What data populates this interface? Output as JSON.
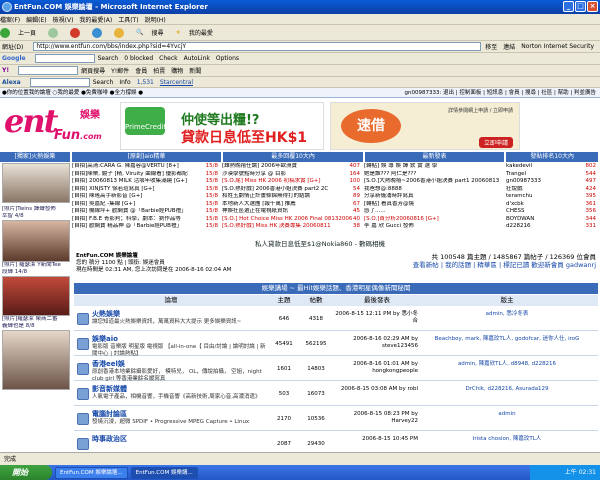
{
  "window": {
    "title": "EntFun.COM 娛樂論壇 - Microsoft Internet Explorer",
    "menu": [
      "檔案(F)",
      "編輯(E)",
      "檢視(V)",
      "我的最愛(A)",
      "工具(T)",
      "說明(H)"
    ]
  },
  "toolbar": {
    "back": "上一頁",
    "search": "搜尋",
    "favorites": "我的最愛",
    "address": "http://www.entfun.com/bbs/index.php?sid=4YvcjY",
    "go": "移至",
    "links": "連結",
    "norton": "Norton Internet Security"
  },
  "google_bar": {
    "search": "Search",
    "blocked": "0 blocked",
    "check": "Check",
    "autolink": "AutoLink",
    "options": "Options"
  },
  "yahoo_bar": [
    "網頁搜尋",
    "Y!郵件",
    "會員",
    "拍賣",
    "購物",
    "新聞",
    "新聞"
  ],
  "alexa_bar": {
    "label": "Alexa",
    "search": "Search",
    "info": "Info",
    "rank": "1,531",
    "site": "Starcentral"
  },
  "page": {
    "toplinks_left": "●你的位置我的論壇 ○我的最愛 ●免費咖啡 ●全力撐娛 ●",
    "toplinks_right": "gn00987333: 退出 | 控制面板 | 短訊息 | 會員 | 搜尋 | 社區 | 幫助 | 判並廣告",
    "logo": {
      "ent": "ent",
      "fun": "Fun",
      "com": ".com",
      "cn": "娛樂"
    },
    "ad1": {
      "brand": "PrimeCredit",
      "line1": "仲使等出糧!?",
      "line2": "貸款日息低至HK$1"
    },
    "ad2": {
      "mascot": "速借",
      "text": "詳情參閱網上申請 / 立即申請",
      "btn": "立即申請"
    },
    "colheads": [
      "[獨家]火熱娛樂",
      "[原創]aio精華",
      "最多回覆10大內",
      "最新發表",
      "發貼排名10大內"
    ],
    "col1": [
      "[照片]Twins 譯聲發佈",
      "萃智 4/8",
      "[照片] 羅瑟潔 Y新聞Tee",
      "段輝 14/8",
      "[照片]羅瑟潔 榮商二番",
      "義輝也是 8/8"
    ],
    "col2": [
      {
        "t": "[自拍]高清:CARA G. 陳嘉容@VERTU [8+]",
        "n": "15/8"
      },
      {
        "t": "[自拍]陳樂, 鏡子 [精, Viruity 曲線看] 優影都配",
        "n": "15/8"
      },
      {
        "t": "[自拍] 20060813 MILK 活壞年收集滿繞 [G+]",
        "n": "15/8"
      },
      {
        "t": "[自拍] XINJSTY 徐若瑄寫真 [G+]",
        "n": "15/8"
      },
      {
        "t": "[自拍] 陳瑤高手新影音 [G+]",
        "n": "15/8"
      },
      {
        "t": "[自拍] 吳嘉紀 -集線 [G+]",
        "n": "15/8"
      },
      {
        "t": "[自拍] 機線坪+ 歡網寶 @「Barbie經PUB禮」",
        "n": "15/8"
      },
      {
        "t": "[自拍] F.B.E 青影判；科學，劇本：劉作品等",
        "n": "15/8"
      },
      {
        "t": "[自拍] 歡網寶 精品神 @「Barbie經PUB禮」",
        "n": "15/8"
      }
    ],
    "col3": [
      {
        "t": "[難熱晚禧仕論] 2006年歐洲寶",
        "n": "407"
      },
      {
        "t": "沙漠學號點時分享 @ 目影",
        "n": "164"
      },
      {
        "t": "[S.O.尾] Miss HK 2006 初稿求實 [G+]",
        "n": "100"
      },
      {
        "t": "[S.O.熱好戲] 2006香港小姐決賽 part2 2C",
        "n": "54"
      },
      {
        "t": "和姓玉劇情正計畫條錦無得打的結論",
        "n": "89"
      },
      {
        "t": "本地新人大選團 [報千萬] 推薦",
        "n": "67"
      },
      {
        "t": "神娛社區選正在電視紙資訊",
        "n": "45"
      },
      {
        "t": "[S.O.] Hot Choice Miss HK 2006 Final 08132006",
        "n": "40"
      },
      {
        "t": "[S.O.熱好戲] Miss HK 決賽專集 20060811",
        "n": "38"
      }
    ],
    "col4": [
      {
        "t": "[轉貼] 娛 導 娛 譯",
        "n": "欽 實 選 學"
      },
      {
        "t": "她是誰??? 阿仁是???",
        "n": ""
      },
      {
        "t": "[S.O.]大熱晚禧~2006香港小姐決賽 part1 20060813",
        "n": ""
      },
      {
        "t": "我爸想@:8888",
        "n": ""
      },
      {
        "t": "分享新儀涌時評寫真",
        "n": ""
      },
      {
        "t": "[轉貼] 看真香芳@燒",
        "n": ""
      },
      {
        "t": "感了......",
        "n": ""
      },
      {
        "t": "[S.O.]首分析20060816 [G+]",
        "n": ""
      },
      {
        "t": "李 嘉 欣 Gucci 發佈",
        "n": ""
      }
    ],
    "col5": [
      {
        "t": "kakedevil",
        "n": "802"
      },
      {
        "t": "Trangel",
        "n": "544"
      },
      {
        "t": "gn00987333",
        "n": "497"
      },
      {
        "t": "狂說戲",
        "n": "424"
      },
      {
        "t": "teramchu",
        "n": "395"
      },
      {
        "t": "d'xcbk",
        "n": "361"
      },
      {
        "t": "CHESS",
        "n": "356"
      },
      {
        "t": "BOYDWAN",
        "n": "344"
      },
      {
        "t": "d228216",
        "n": "331"
      },
      {
        "t": "sharonhe",
        "n": "330"
      }
    ],
    "promo": "私人貸款日息低至$1@Nokia860 - 數碼相機",
    "userinfo": [
      "EntFun.COM 娛樂論壇",
      "您的 積分 1100 點 | 頭銜: 娛迷會員",
      "現在時間是 02:31 AM, 您上次訪問是在 2006-8-16 02:04 AM"
    ],
    "stats": {
      "line1": "共 100548 篇主題 / 1485867 篇帖子 / 126369 位會員",
      "line2": "查看新帖 | 我的話題 | 精華區 | 標記已讀 歡迎新會員 gadwanrj"
    },
    "forum_head": "娛樂講場 ~ 最Hit娛樂話題、香港明星偶像新聞秘聞",
    "forum_cols": [
      "論壇",
      "主題",
      "帖數",
      "最後發表",
      "版主"
    ],
    "forums": [
      {
        "title": "火熱娛樂",
        "desc": "讓您知道最火熱娛樂資訊，萬萬資料大大提示 更多娛樂資訊~",
        "topics": "646",
        "posts": "4318",
        "last": "2006-8-15 12:11 PM by 悉小冬 合",
        "mods": "admin, 悉冷冬表"
      },
      {
        "title": "娛樂aio",
        "desc": "電影版 音樂版 明星版 電視版 【all-in-one【 目由/討論 | 論明討論 | 新聞中心 | 討論熱點】",
        "topics": "45491",
        "posts": "562195",
        "last": "2006-8-16 02:29 AM by steve123456",
        "mods": "Beachboy, mark, 陳嘉玟TL人, godofcar, 迷你人仕, iroG"
      },
      {
        "title": "香港eel娛",
        "desc": "原創香港本地業餘攝影愛好， 模特兒， OL，傳說拍攝， 空姐，night club girl 等香港業餘名媛寫真",
        "topics": "1601",
        "posts": "14803",
        "last": "2006-8-16 01:01 AM by hongkongpeople",
        "mods": "admin, 陳嘉欣TL人, d8948, d228216"
      },
      {
        "title": "影音新媒體",
        "desc": "人氣電子產品，相機音響，手機音響《高新技術,周家心音,高濃消遣》",
        "topics": "503",
        "posts": "16073",
        "last": "2006-8-15 03:08 AM by robl",
        "mods": "DrChik, d228216, Asurada129"
      },
      {
        "title": "電腦討論區",
        "desc": "發燒沉浸，超微 SPDIF • Progressive MPEG Capture • Linux",
        "topics": "2170",
        "posts": "10536",
        "last": "2006-8-15 08:23 PM by Harvey22",
        "mods": "admin"
      },
      {
        "title": "時事政治区",
        "desc": "",
        "topics": "2087",
        "posts": "29430",
        "last": "2006-8-15 10:45 PM",
        "mods": "Irista chosion, 陳嘉玟TL人"
      }
    ]
  },
  "status": "完成",
  "taskbar": {
    "start": "開始",
    "tasks": [
      "EntFun.COM 娛樂論壇...",
      "EntFun.COM 娛樂講..."
    ],
    "clock": "上午 02:31"
  }
}
